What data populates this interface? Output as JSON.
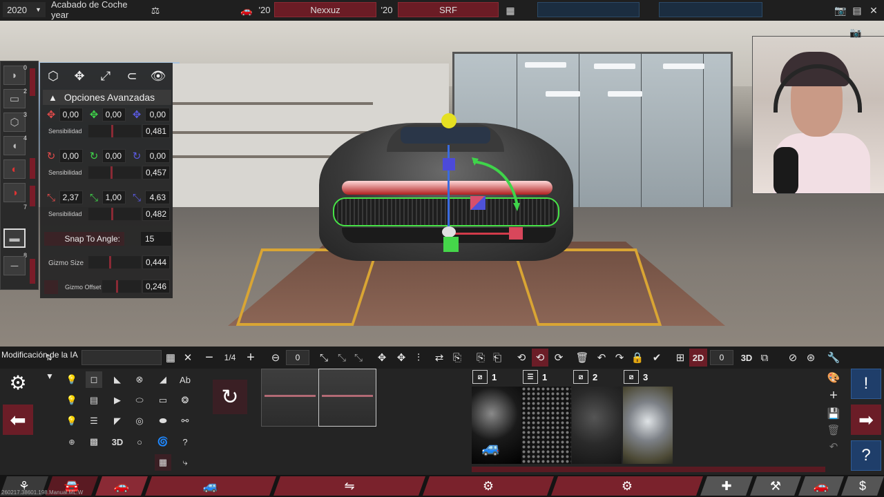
{
  "topbar": {
    "year": "2020",
    "year_arrow": "▼",
    "trim_label": "Acabado de Coche year",
    "engine_year": "'20",
    "engine_name": "Nexxuz",
    "variant_year": "'20",
    "variant_name": "SRF"
  },
  "panel": {
    "advanced_title": "Opciones Avanzadas",
    "position": {
      "x": "0,00",
      "y": "0,00",
      "z": "0,00",
      "sensitivity_label": "Sensibilidad",
      "sensitivity": "0,481"
    },
    "rotation": {
      "x": "0,00",
      "y": "0,00",
      "z": "0,00",
      "sensitivity_label": "Sensibilidad",
      "sensitivity": "0,457"
    },
    "scale": {
      "x": "2,37",
      "y": "1,00",
      "z": "4,63",
      "sensitivity_label": "Sensibilidad",
      "sensitivity": "0,482"
    },
    "snap_label": "Snap To Angle:",
    "snap_value": "15",
    "gizmo_size_label": "Gizmo Size",
    "gizmo_size": "0,444",
    "gizmo_offset_label": "Gizmo Offset",
    "gizmo_offset": "0,246"
  },
  "leftstrip": {
    "numbers": [
      "0",
      "2",
      "3",
      "4",
      "7",
      "8"
    ]
  },
  "toolbar": {
    "mod_label": "Modificación de la IA",
    "page_indicator": "1/4",
    "layer_value": "0",
    "mode_2d": "2D",
    "mode_value": "0",
    "mode_3d": "3D"
  },
  "shapes": {
    "text_tool": "Ab",
    "threed_tool": "3D"
  },
  "materials": {
    "counts": [
      "1",
      "1",
      "2",
      "3"
    ]
  },
  "version_text": "260217.38601.198.Manual.ML.W",
  "colors": {
    "accent_red": "#6b1d27",
    "accent_blue": "#1f3e6a",
    "gizmo_green": "#45d64a",
    "gizmo_yellow": "#e5e022"
  }
}
